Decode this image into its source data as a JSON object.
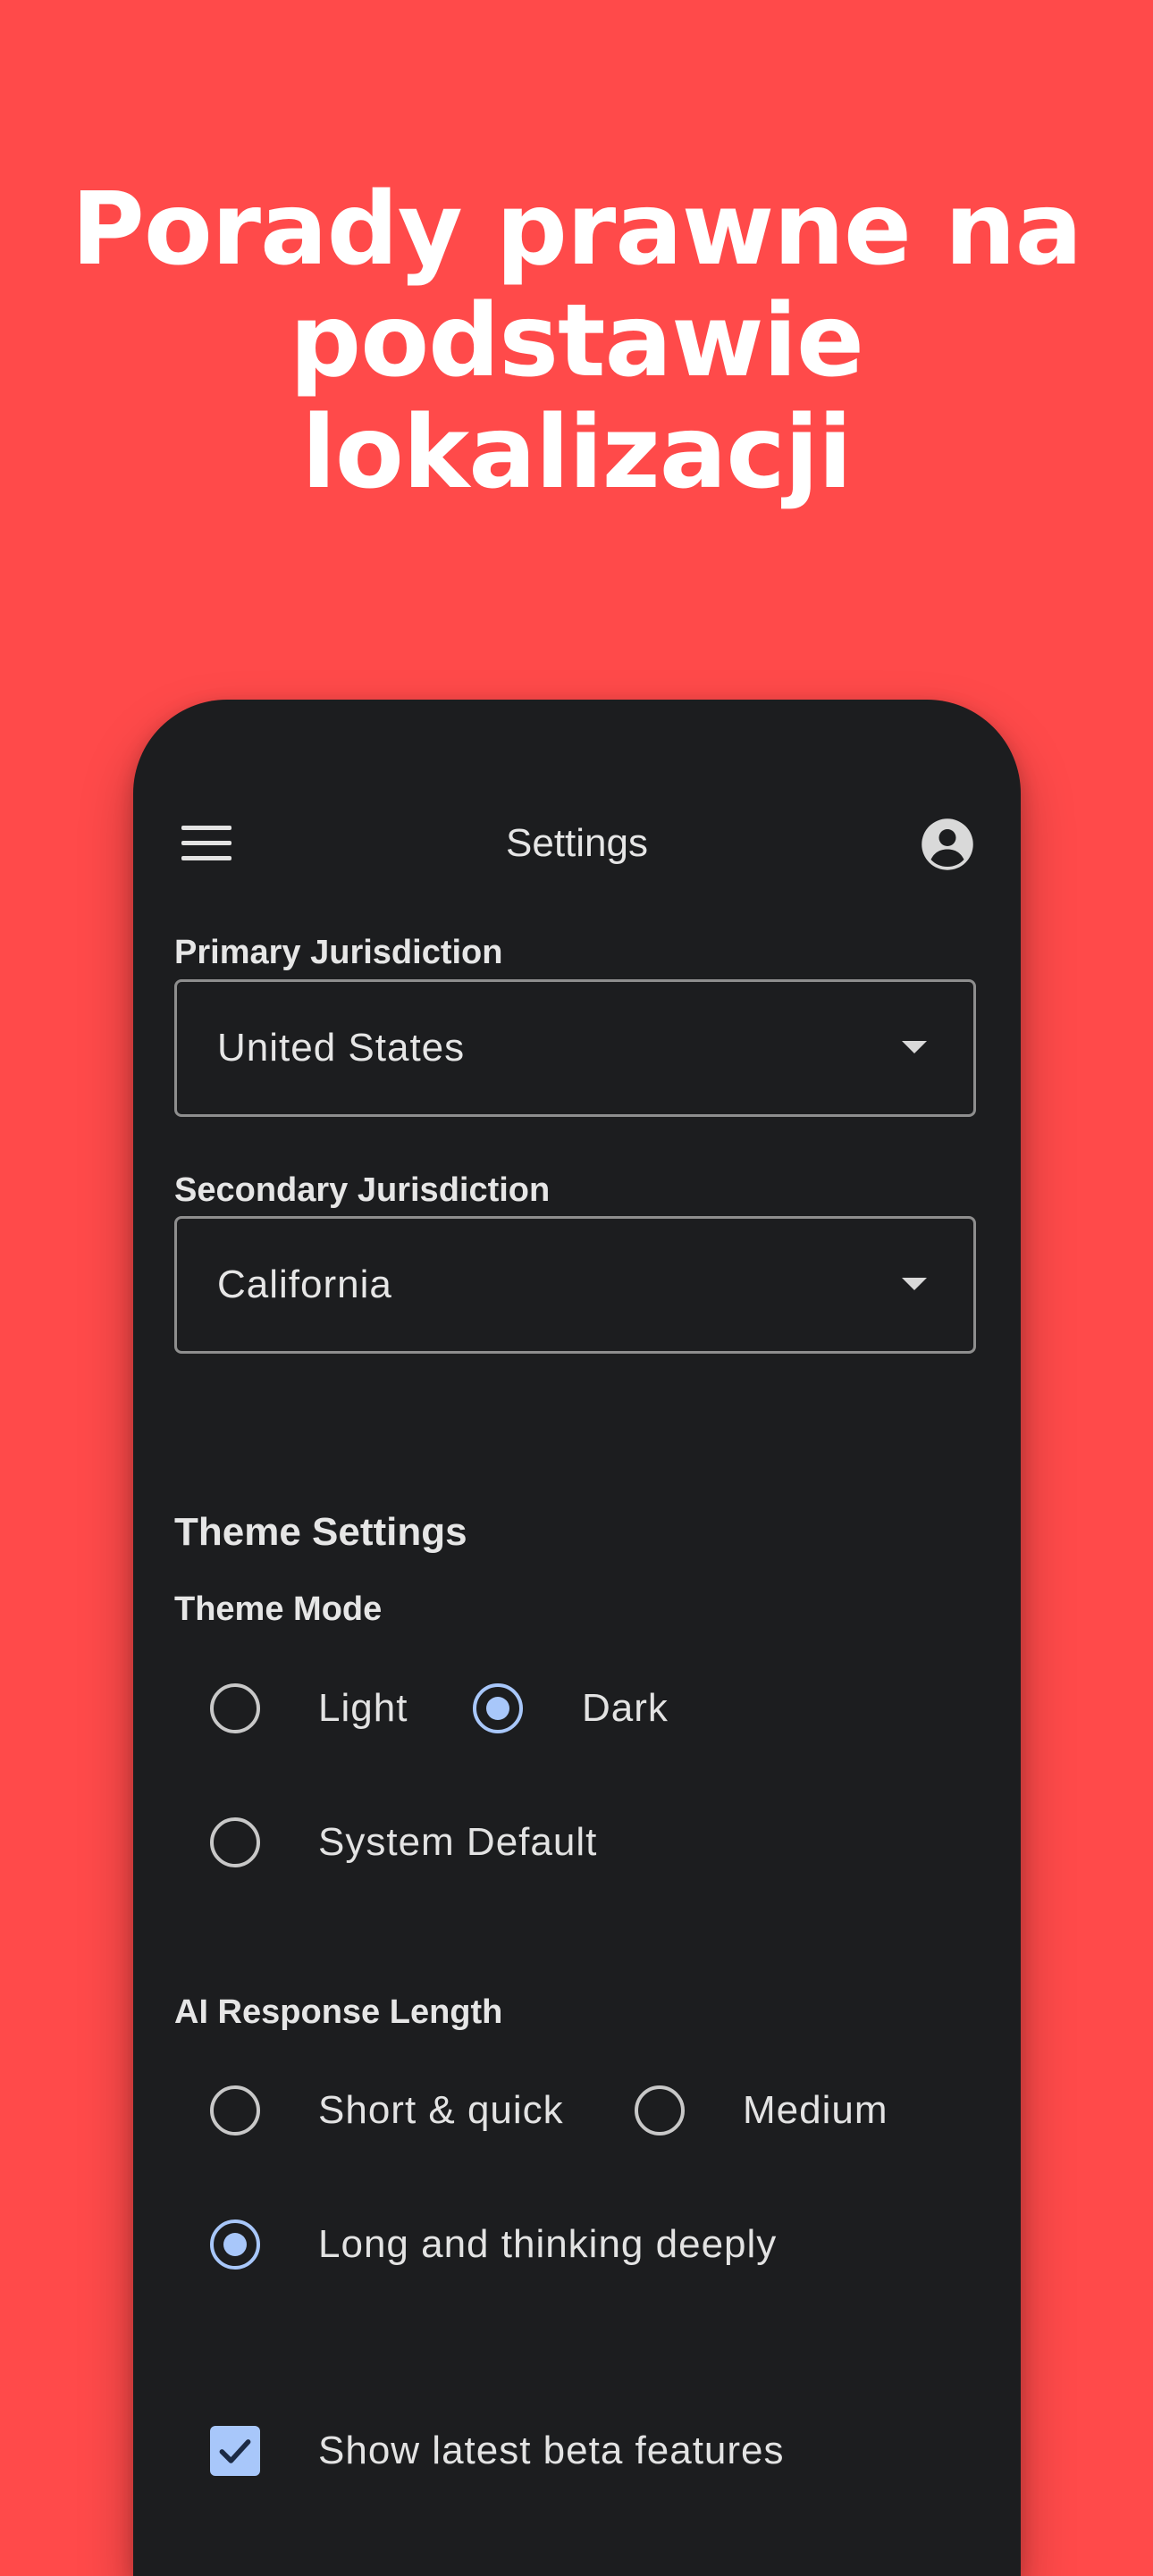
{
  "headline": {
    "line1": "Porady prawne na",
    "line2": "podstawie",
    "line3": "lokalizacji"
  },
  "appbar": {
    "title": "Settings",
    "menu_icon": "menu-icon",
    "account_icon": "account-circle-icon"
  },
  "primary_jurisdiction": {
    "label": "Primary Jurisdiction",
    "value": "United States"
  },
  "secondary_jurisdiction": {
    "label": "Secondary Jurisdiction",
    "value": "California"
  },
  "theme": {
    "section_title": "Theme Settings",
    "mode_label": "Theme Mode",
    "options": [
      {
        "label": "Light",
        "selected": false
      },
      {
        "label": "Dark",
        "selected": true
      },
      {
        "label": "System Default",
        "selected": false
      }
    ]
  },
  "ai_response": {
    "label": "AI Response Length",
    "options": [
      {
        "label": "Short & quick",
        "selected": false
      },
      {
        "label": "Medium",
        "selected": false
      },
      {
        "label": "Long and thinking deeply",
        "selected": true
      }
    ]
  },
  "beta": {
    "label": "Show latest beta features",
    "checked": true
  },
  "colors": {
    "background": "#FF4A4A",
    "surface": "#1C1D1F",
    "accent": "#A8C7FA"
  }
}
